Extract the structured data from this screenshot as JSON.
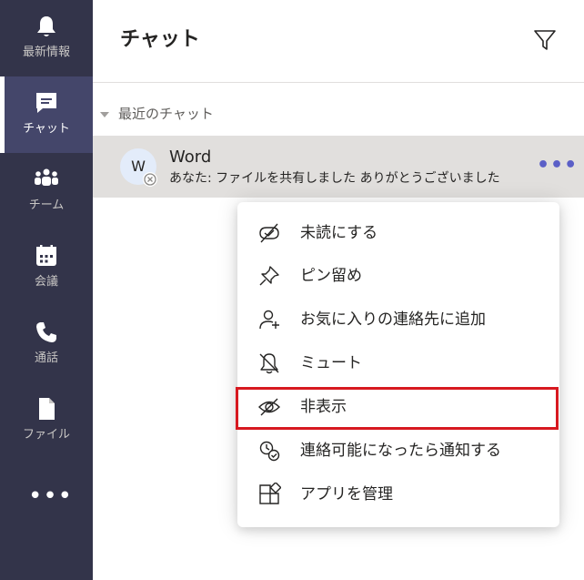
{
  "rail": {
    "items": [
      {
        "label": "最新情報",
        "icon": "bell-icon"
      },
      {
        "label": "チャット",
        "icon": "chat-icon",
        "active": true
      },
      {
        "label": "チーム",
        "icon": "teams-icon"
      },
      {
        "label": "会議",
        "icon": "calendar-icon"
      },
      {
        "label": "通話",
        "icon": "phone-icon"
      },
      {
        "label": "ファイル",
        "icon": "file-icon"
      }
    ],
    "more_label": "•••"
  },
  "header": {
    "title": "チャット",
    "filter_icon": "filter-icon"
  },
  "recent": {
    "section_label": "最近のチャット"
  },
  "chat_row": {
    "avatar_initial": "W",
    "name": "Word",
    "preview": "あなた: ファイルを共有しました ありがとうございました",
    "more_label": "•••"
  },
  "context_menu": {
    "items": [
      {
        "label": "未読にする",
        "icon": "mark-unread-icon"
      },
      {
        "label": "ピン留め",
        "icon": "pin-icon"
      },
      {
        "label": "お気に入りの連絡先に追加",
        "icon": "add-favorite-contact-icon"
      },
      {
        "label": "ミュート",
        "icon": "mute-bell-icon"
      },
      {
        "label": "非表示",
        "icon": "hide-eye-icon",
        "highlighted": true
      },
      {
        "label": "連絡可能になったら通知する",
        "icon": "notify-available-icon"
      },
      {
        "label": "アプリを管理",
        "icon": "manage-apps-icon"
      }
    ]
  },
  "colors": {
    "rail_bg": "#33344a",
    "rail_active": "#44466a",
    "accent": "#5b5fc7",
    "highlight_border": "#d71920",
    "row_selected": "#e1dfdd"
  }
}
